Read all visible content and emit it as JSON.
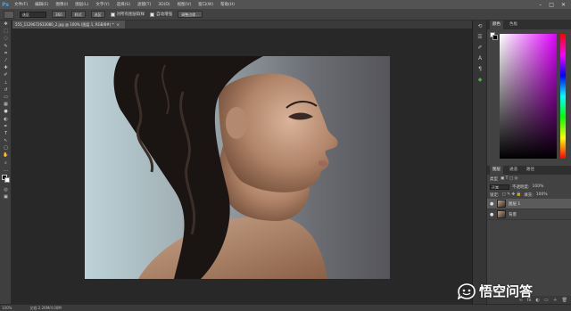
{
  "app": {
    "logo": "Ps"
  },
  "menu": [
    "文件(F)",
    "编辑(E)",
    "图像(I)",
    "图层(L)",
    "文字(Y)",
    "选择(S)",
    "滤镜(T)",
    "3D(D)",
    "视图(V)",
    "窗口(W)",
    "帮助(H)"
  ],
  "window_controls": [
    "–",
    "□",
    "✕"
  ],
  "options": {
    "mode_value": "选区",
    "btn1": "360",
    "btn2": "样式",
    "btn3": "选区",
    "sample_all_layers": "对所有图层取样",
    "enhance_edge": "自动增强",
    "refine_edge": "调整边缘..."
  },
  "document": {
    "tab_title": "555_1129672633080_2.jpg @ 100% (图层 1, RGB/8#) *",
    "close": "×"
  },
  "status": {
    "zoom": "100%",
    "doc_size": "文档:2.26M/4.00M"
  },
  "panels": {
    "color_tab": "颜色",
    "swatch_tab": "色板",
    "layers_tab": "图层",
    "channels_tab": "通道",
    "paths_tab": "路径",
    "kind_label": "类型",
    "blend_mode": "正常",
    "opacity_label": "不透明度:",
    "opacity_value": "100%",
    "lock_label": "锁定:",
    "fill_label": "填充:",
    "fill_value": "100%"
  },
  "layers": [
    {
      "name": "图层 1",
      "visible": true,
      "selected": true
    },
    {
      "name": "背景",
      "visible": true,
      "selected": false
    }
  ],
  "watermark": {
    "text": "悟空问答"
  },
  "colors": {
    "menubar": "#535353",
    "workspace": "#282828",
    "panel": "#424242",
    "accent": "#31a8ff"
  }
}
